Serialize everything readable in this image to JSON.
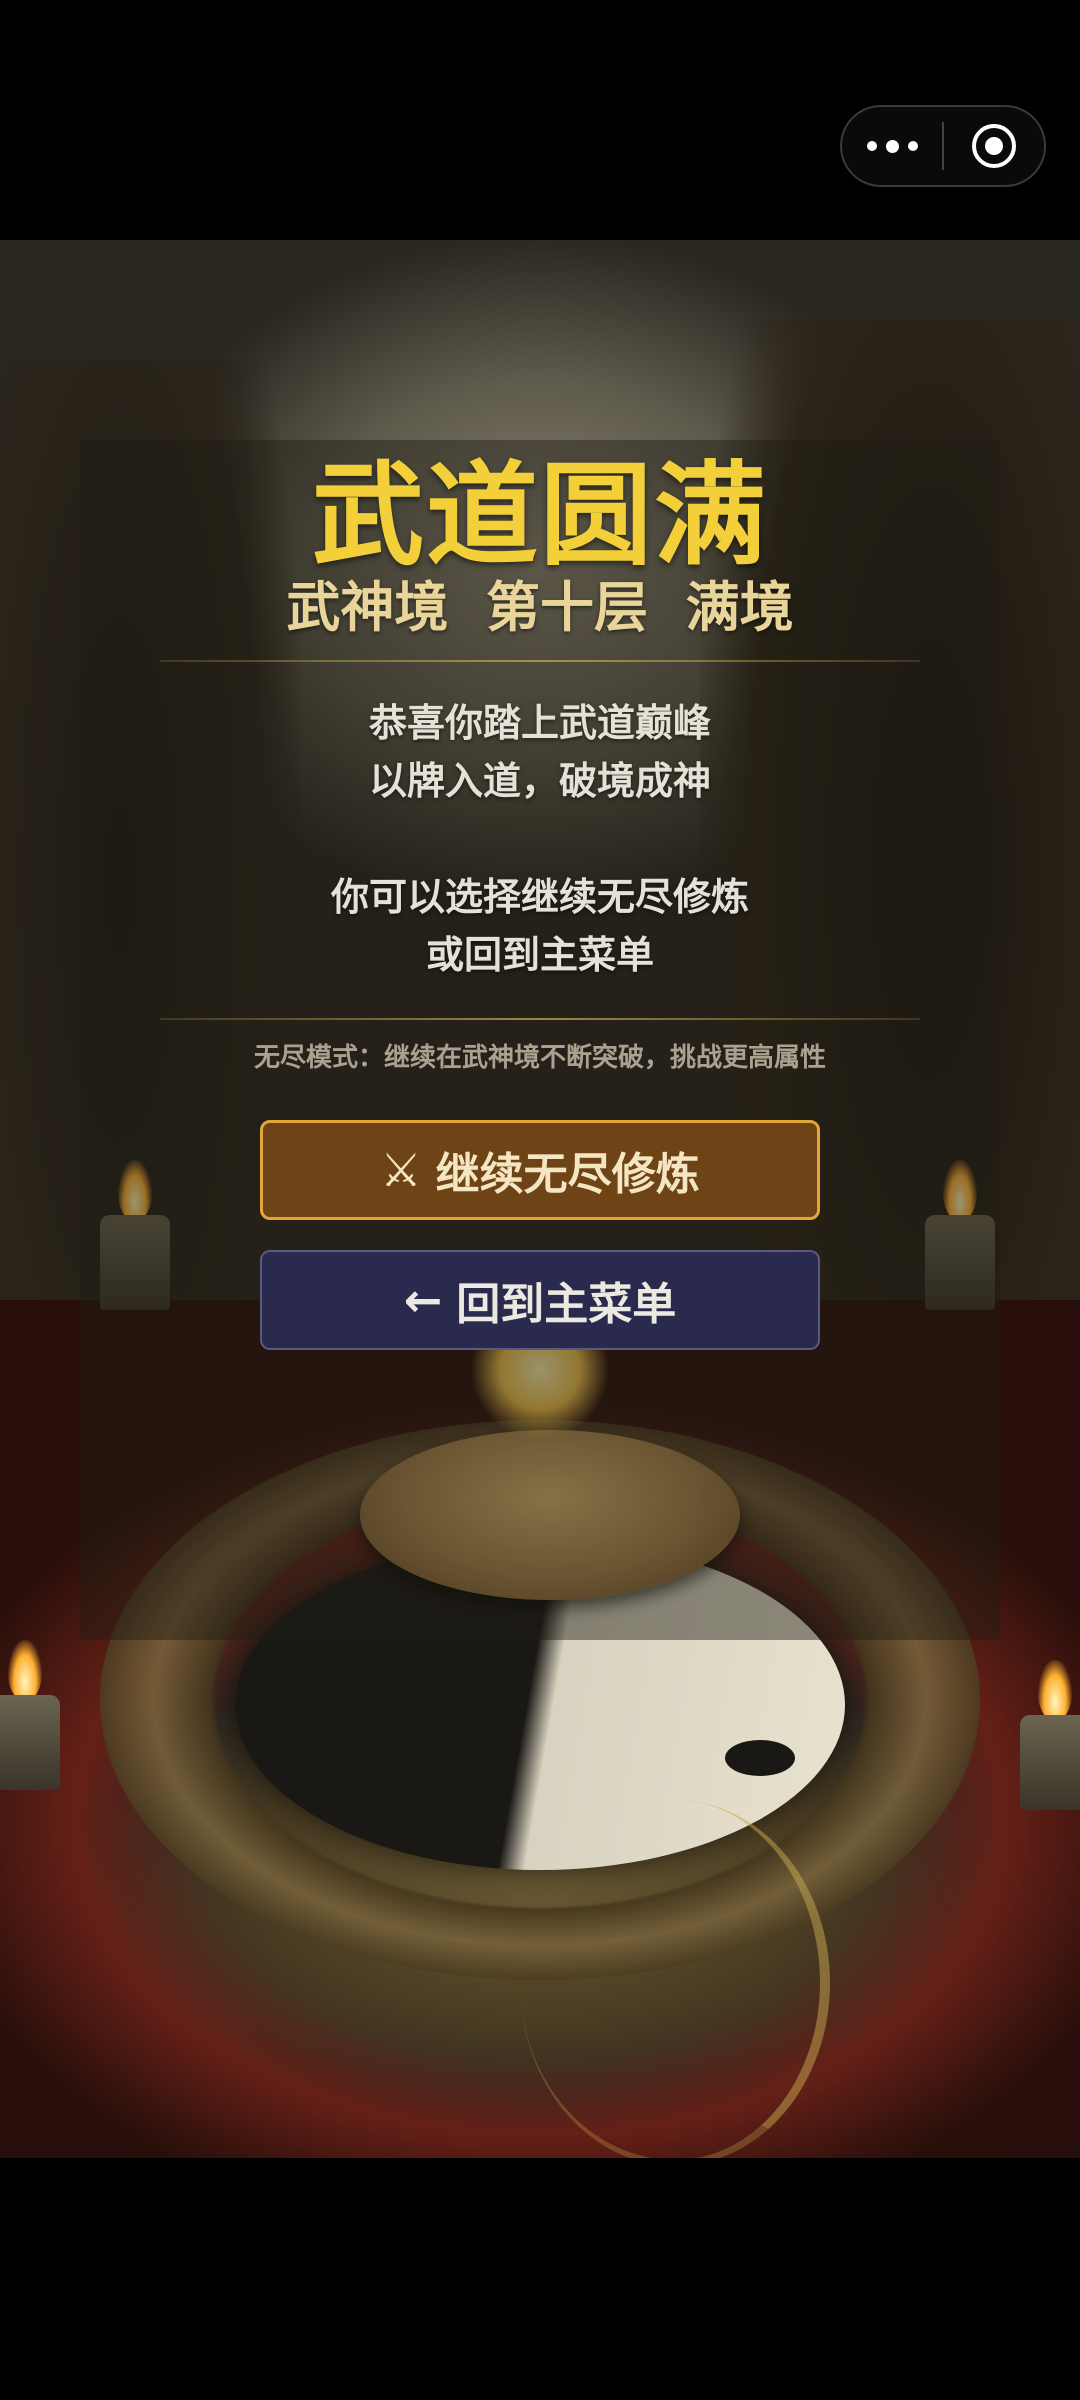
{
  "capsule": {
    "more_icon": "more-dots-icon",
    "close_icon": "target-close-icon"
  },
  "result": {
    "title": "武道圆满",
    "subtitle": "武神境  第十层  满境",
    "congrats_line1": "恭喜你踏上武道巅峰",
    "congrats_line2": "以牌入道，破境成神",
    "choice_line1": "你可以选择继续无尽修炼",
    "choice_line2": "或回到主菜单",
    "hint": "无尽模式：继续在武神境不断突破，挑战更高属性"
  },
  "buttons": {
    "endless_icon": "⚔",
    "endless_label": "继续无尽修炼",
    "menu_icon": "←",
    "menu_label": "回到主菜单"
  },
  "colors": {
    "title": "#f3cf3a",
    "endless_button_bg": "#6e4315",
    "endless_button_border": "#e2a73a",
    "menu_button_bg": "#2a2a4e"
  }
}
